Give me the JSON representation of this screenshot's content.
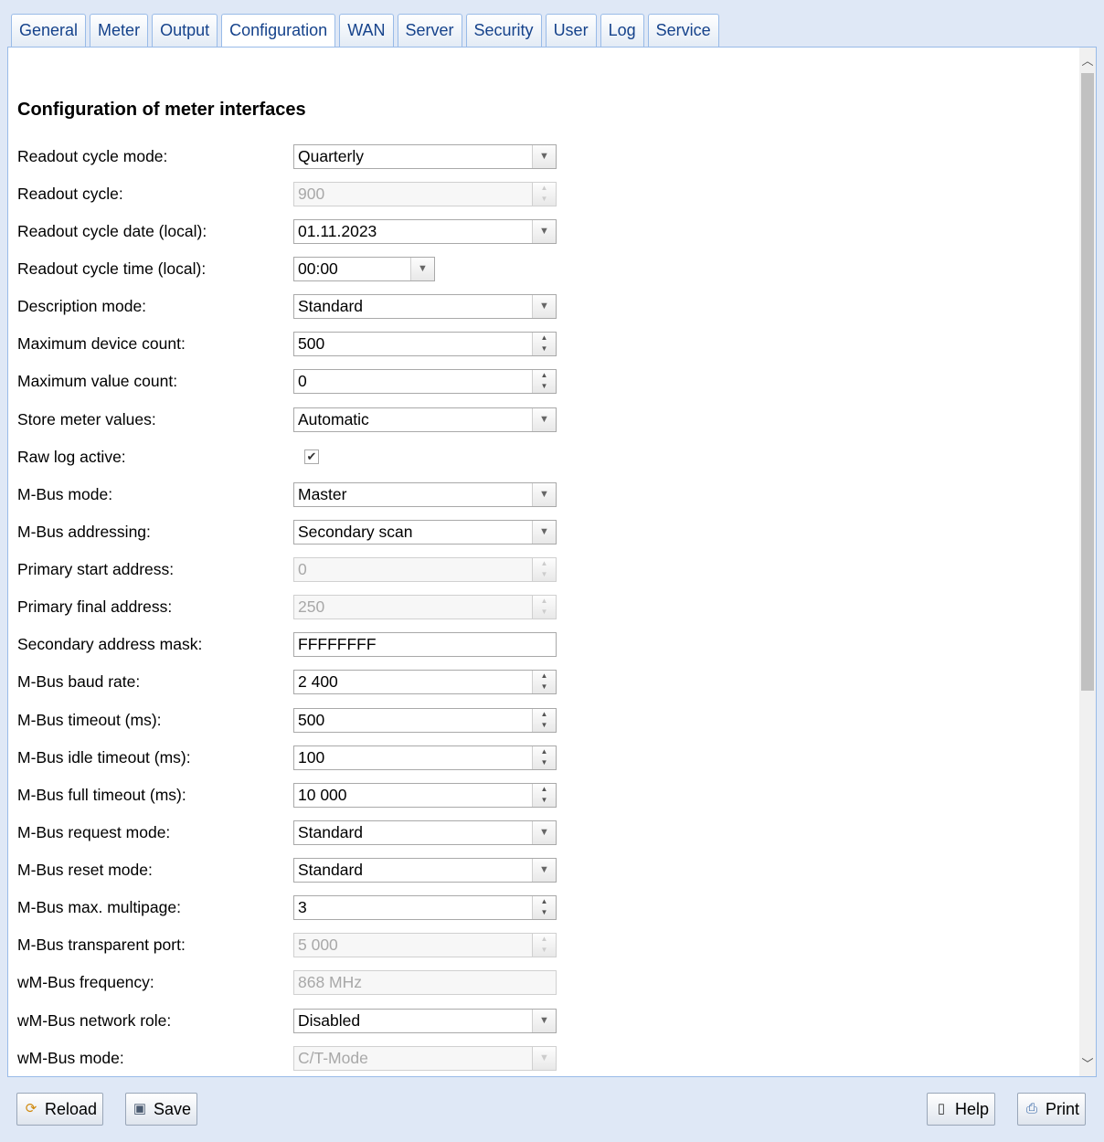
{
  "tabs": [
    "General",
    "Meter",
    "Output",
    "Configuration",
    "WAN",
    "Server",
    "Security",
    "User",
    "Log",
    "Service"
  ],
  "active_tab": "Configuration",
  "section_title": "Configuration of meter interfaces",
  "fields": {
    "readout_cycle_mode": {
      "label": "Readout cycle mode:",
      "value": "Quarterly"
    },
    "readout_cycle": {
      "label": "Readout cycle:",
      "value": "900"
    },
    "readout_cycle_date": {
      "label": "Readout cycle date (local):",
      "value": "01.11.2023"
    },
    "readout_cycle_time": {
      "label": "Readout cycle time (local):",
      "value": "00:00"
    },
    "description_mode": {
      "label": "Description mode:",
      "value": "Standard"
    },
    "max_device_count": {
      "label": "Maximum device count:",
      "value": "500"
    },
    "max_value_count": {
      "label": "Maximum value count:",
      "value": "0"
    },
    "store_meter_values": {
      "label": "Store meter values:",
      "value": "Automatic"
    },
    "raw_log_active": {
      "label": "Raw log active:",
      "checked": true
    },
    "mbus_mode": {
      "label": "M-Bus mode:",
      "value": "Master"
    },
    "mbus_addressing": {
      "label": "M-Bus addressing:",
      "value": "Secondary scan"
    },
    "primary_start_address": {
      "label": "Primary start address:",
      "value": "0"
    },
    "primary_final_address": {
      "label": "Primary final address:",
      "value": "250"
    },
    "secondary_address_mask": {
      "label": "Secondary address mask:",
      "value": "FFFFFFFF"
    },
    "mbus_baud_rate": {
      "label": "M-Bus baud rate:",
      "value": "2 400"
    },
    "mbus_timeout": {
      "label": "M-Bus timeout (ms):",
      "value": "500"
    },
    "mbus_idle_timeout": {
      "label": "M-Bus idle timeout (ms):",
      "value": "100"
    },
    "mbus_full_timeout": {
      "label": "M-Bus full timeout (ms):",
      "value": "10 000"
    },
    "mbus_request_mode": {
      "label": "M-Bus request mode:",
      "value": "Standard"
    },
    "mbus_reset_mode": {
      "label": "M-Bus reset mode:",
      "value": "Standard"
    },
    "mbus_max_multipage": {
      "label": "M-Bus max. multipage:",
      "value": "3"
    },
    "mbus_transparent_port": {
      "label": "M-Bus transparent port:",
      "value": "5 000"
    },
    "wmbus_frequency": {
      "label": "wM-Bus frequency:",
      "value": "868 MHz"
    },
    "wmbus_network_role": {
      "label": "wM-Bus network role:",
      "value": "Disabled"
    },
    "wmbus_mode": {
      "label": "wM-Bus mode:",
      "value": "C/T-Mode"
    }
  },
  "toolbar": {
    "reload": "Reload",
    "save": "Save",
    "help": "Help",
    "print": "Print"
  },
  "icons": {
    "reload": "reload-icon",
    "save": "save-icon",
    "help": "help-icon",
    "print": "print-icon"
  }
}
